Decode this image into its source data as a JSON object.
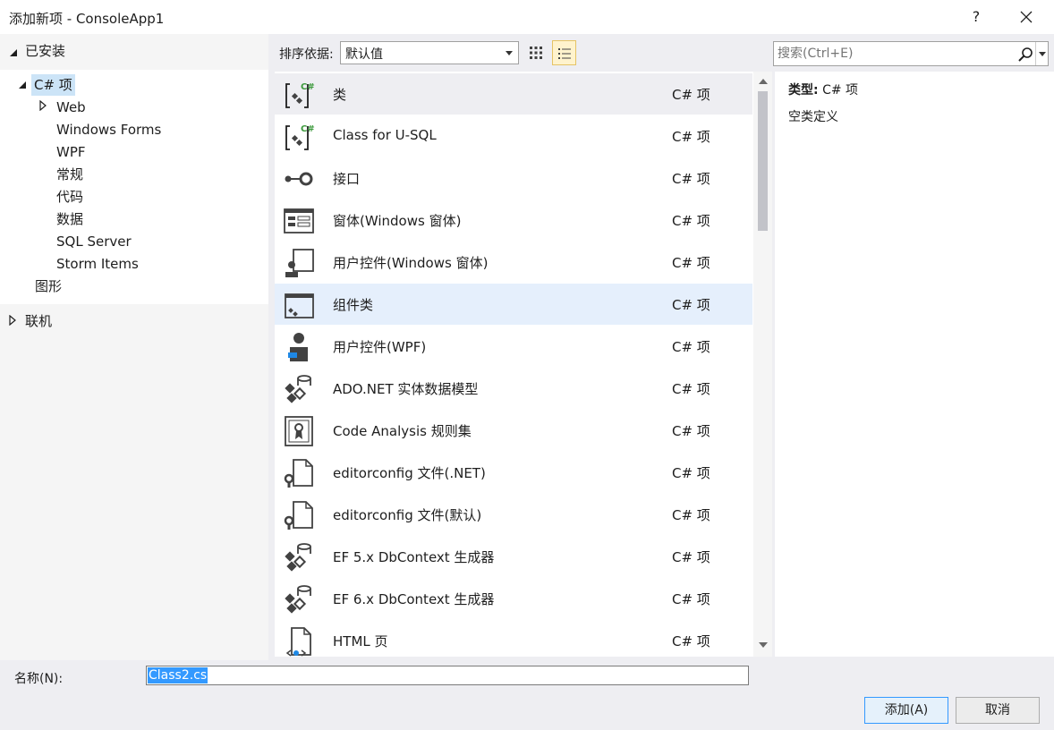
{
  "window": {
    "title": "添加新项 - ConsoleApp1",
    "help_label": "?"
  },
  "tree": {
    "installed_label": "已安装",
    "root_label": "C# 项",
    "children": [
      "Web",
      "Windows Forms",
      "WPF",
      "常规",
      "代码",
      "数据",
      "SQL Server",
      "Storm Items"
    ],
    "graphics_label": "图形",
    "online_label": "联机"
  },
  "toolbar": {
    "sort_label": "排序依据:",
    "sort_value": "默认值",
    "search_placeholder": "搜索(Ctrl+E)"
  },
  "items": [
    {
      "name": "类",
      "lang": "C# 项",
      "icon": "class-icon"
    },
    {
      "name": "Class for U-SQL",
      "lang": "C# 项",
      "icon": "class-icon"
    },
    {
      "name": "接口",
      "lang": "C# 项",
      "icon": "interface-icon"
    },
    {
      "name": "窗体(Windows 窗体)",
      "lang": "C# 项",
      "icon": "form-icon"
    },
    {
      "name": "用户控件(Windows 窗体)",
      "lang": "C# 项",
      "icon": "user-control-icon"
    },
    {
      "name": "组件类",
      "lang": "C# 项",
      "icon": "component-icon"
    },
    {
      "name": "用户控件(WPF)",
      "lang": "C# 项",
      "icon": "wpf-user-control-icon"
    },
    {
      "name": "ADO.NET 实体数据模型",
      "lang": "C# 项",
      "icon": "data-model-icon"
    },
    {
      "name": "Code Analysis 规则集",
      "lang": "C# 项",
      "icon": "ruleset-icon"
    },
    {
      "name": "editorconfig 文件(.NET)",
      "lang": "C# 项",
      "icon": "config-file-icon"
    },
    {
      "name": "editorconfig 文件(默认)",
      "lang": "C# 项",
      "icon": "config-file-icon"
    },
    {
      "name": "EF 5.x DbContext 生成器",
      "lang": "C# 项",
      "icon": "data-model-icon"
    },
    {
      "name": "EF 6.x DbContext 生成器",
      "lang": "C# 项",
      "icon": "data-model-icon"
    },
    {
      "name": "HTML 页",
      "lang": "C# 项",
      "icon": "html-page-icon"
    }
  ],
  "details": {
    "type_label": "类型:",
    "type_value": "C# 项",
    "description": "空类定义"
  },
  "bottom": {
    "name_label": "名称(N):",
    "name_value": "Class2.cs",
    "add_label": "添加(A)",
    "cancel_label": "取消"
  },
  "colors": {
    "accent": "#3399ff",
    "selected_row": "#e5effc",
    "tree_selected": "#cce4f7",
    "icon_green": "#3c9a3c"
  }
}
